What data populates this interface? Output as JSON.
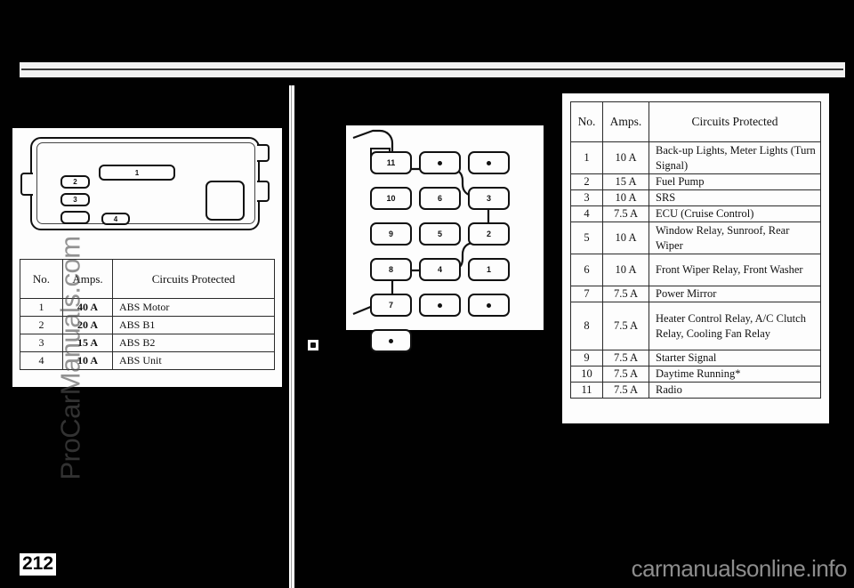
{
  "page": {
    "number": "212",
    "watermark_side": "ProCarManuals.com",
    "watermark_bottom": "carmanualsonline.info"
  },
  "columns": {
    "no": "No.",
    "amps": "Amps.",
    "circuits": "Circuits Protected"
  },
  "abs_diagram": {
    "title": "abs-fuse-box-diagram",
    "fuses": [
      {
        "label": "1",
        "id": "abs-f1"
      },
      {
        "label": "2",
        "id": "abs-f2"
      },
      {
        "label": "3",
        "id": "abs-f3"
      },
      {
        "label": "",
        "id": "abs-fblank"
      },
      {
        "label": "4",
        "id": "abs-f4"
      }
    ]
  },
  "abs_table": {
    "rows": [
      {
        "no": "1",
        "amps": "40 A",
        "circuits": "ABS Motor"
      },
      {
        "no": "2",
        "amps": "20 A",
        "circuits": "ABS B1"
      },
      {
        "no": "3",
        "amps": "15 A",
        "circuits": "ABS B2"
      },
      {
        "no": "4",
        "amps": "10 A",
        "circuits": "ABS Unit"
      }
    ]
  },
  "interior_diagram": {
    "title": "interior-fuse-panel-diagram",
    "slots": [
      {
        "label": "11",
        "type": "numbered"
      },
      {
        "label": "",
        "type": "dot"
      },
      {
        "label": "",
        "type": "dot"
      },
      {
        "label": "10",
        "type": "numbered"
      },
      {
        "label": "6",
        "type": "numbered"
      },
      {
        "label": "3",
        "type": "numbered"
      },
      {
        "label": "9",
        "type": "numbered"
      },
      {
        "label": "5",
        "type": "numbered"
      },
      {
        "label": "2",
        "type": "numbered"
      },
      {
        "label": "8",
        "type": "numbered"
      },
      {
        "label": "4",
        "type": "numbered"
      },
      {
        "label": "1",
        "type": "numbered"
      },
      {
        "label": "7",
        "type": "numbered"
      },
      {
        "label": "",
        "type": "dot"
      },
      {
        "label": "",
        "type": "dot"
      },
      {
        "label": "",
        "type": "dot"
      }
    ]
  },
  "interior_table": {
    "rows": [
      {
        "no": "1",
        "amps": "10 A",
        "circuits": "Back-up Lights, Meter Lights (Turn Signal)"
      },
      {
        "no": "2",
        "amps": "15 A",
        "circuits": "Fuel Pump"
      },
      {
        "no": "3",
        "amps": "10 A",
        "circuits": "SRS"
      },
      {
        "no": "4",
        "amps": "7.5 A",
        "circuits": "ECU (Cruise Control)"
      },
      {
        "no": "5",
        "amps": "10 A",
        "circuits": "Window Relay, Sunroof, Rear Wiper"
      },
      {
        "no": "6",
        "amps": "10 A",
        "circuits": "Front Wiper Relay, Front Washer"
      },
      {
        "no": "7",
        "amps": "7.5 A",
        "circuits": "Power Mirror"
      },
      {
        "no": "8",
        "amps": "7.5 A",
        "circuits": "Heater Control Relay, A/C Clutch Relay, Cooling Fan Relay"
      },
      {
        "no": "9",
        "amps": "7.5 A",
        "circuits": "Starter Signal"
      },
      {
        "no": "10",
        "amps": "7.5 A",
        "circuits": "Daytime Running*"
      },
      {
        "no": "11",
        "amps": "7.5 A",
        "circuits": "Radio"
      }
    ]
  }
}
